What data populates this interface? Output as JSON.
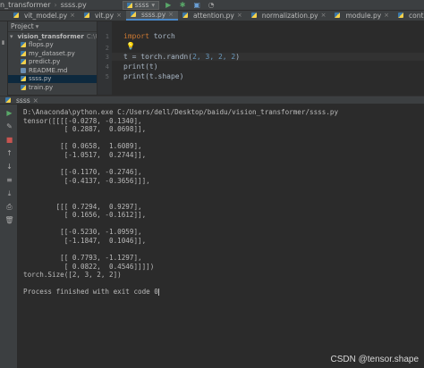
{
  "nav": {
    "crumb1": "n_transformer",
    "crumb2": "ssss.py",
    "run_config": "ssss"
  },
  "tabs": [
    {
      "label": "vit_model.py"
    },
    {
      "label": "vit.py"
    },
    {
      "label": "ssss.py"
    },
    {
      "label": "attention.py"
    },
    {
      "label": "normalization.py"
    },
    {
      "label": "module.py"
    },
    {
      "label": "contain"
    }
  ],
  "project": {
    "header": "Project",
    "root": "vision_transformer",
    "root_path": "C:\\Users\\d",
    "files": [
      "flops.py",
      "my_dataset.py",
      "predict.py",
      "README.md",
      "ssss.py",
      "train.py"
    ]
  },
  "editor": {
    "line_numbers": [
      "1",
      "2",
      "3",
      "4",
      "5"
    ],
    "lines": {
      "l1_kw": "import",
      "l1_rest": " torch",
      "l3_pre": "t = torch.randn(",
      "l3_args": "2, 3, 2, 2",
      "l3_post": ")",
      "l4": "print(t)",
      "l5": "print(t.shape)"
    }
  },
  "run": {
    "tab_label": "ssss",
    "console": [
      "D:\\Anaconda\\python.exe C:/Users/dell/Desktop/baidu/vision_transformer/ssss.py",
      "tensor([[[[-0.0278, -0.1340],",
      "          [ 0.2887,  0.0698]],",
      "",
      "         [[ 0.0658,  1.6089],",
      "          [-1.0517,  0.2744]],",
      "",
      "         [[-0.1170, -0.2746],",
      "          [-0.4137, -0.3656]]],",
      "",
      "",
      "        [[[ 0.7294,  0.9297],",
      "          [ 0.1656, -0.1612]],",
      "",
      "         [[-0.5230, -1.0959],",
      "          [-1.1847,  0.1046]],",
      "",
      "         [[ 0.7793, -1.1297],",
      "          [ 0.0822,  0.4546]]]])",
      "torch.Size([2, 3, 2, 2])",
      "",
      "Process finished with exit code 0"
    ]
  },
  "watermark": "CSDN @tensor.shape"
}
